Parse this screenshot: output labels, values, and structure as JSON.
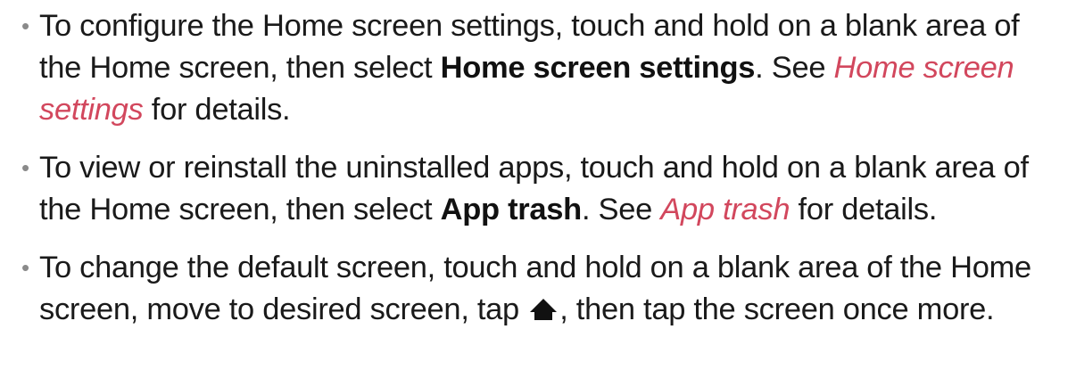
{
  "items": [
    {
      "t1": "To configure the Home screen settings, touch and hold on a blank area of the Home screen, then select ",
      "bold": "Home screen settings",
      "t2": ". See ",
      "link": "Home screen settings",
      "t3": " for details."
    },
    {
      "t1": "To view or reinstall the uninstalled apps, touch and hold on a blank area of the Home screen, then select ",
      "bold": "App trash",
      "t2": ". See ",
      "link": "App trash",
      "t3": " for details."
    },
    {
      "t1": "To change the default screen, touch and hold on a blank area of the Home screen, move to desired screen, tap ",
      "icon": "home-icon",
      "t2": ", then tap the screen once more."
    }
  ],
  "colors": {
    "text": "#1a1a1a",
    "link": "#d2475d",
    "bullet": "#8a8a8a"
  }
}
